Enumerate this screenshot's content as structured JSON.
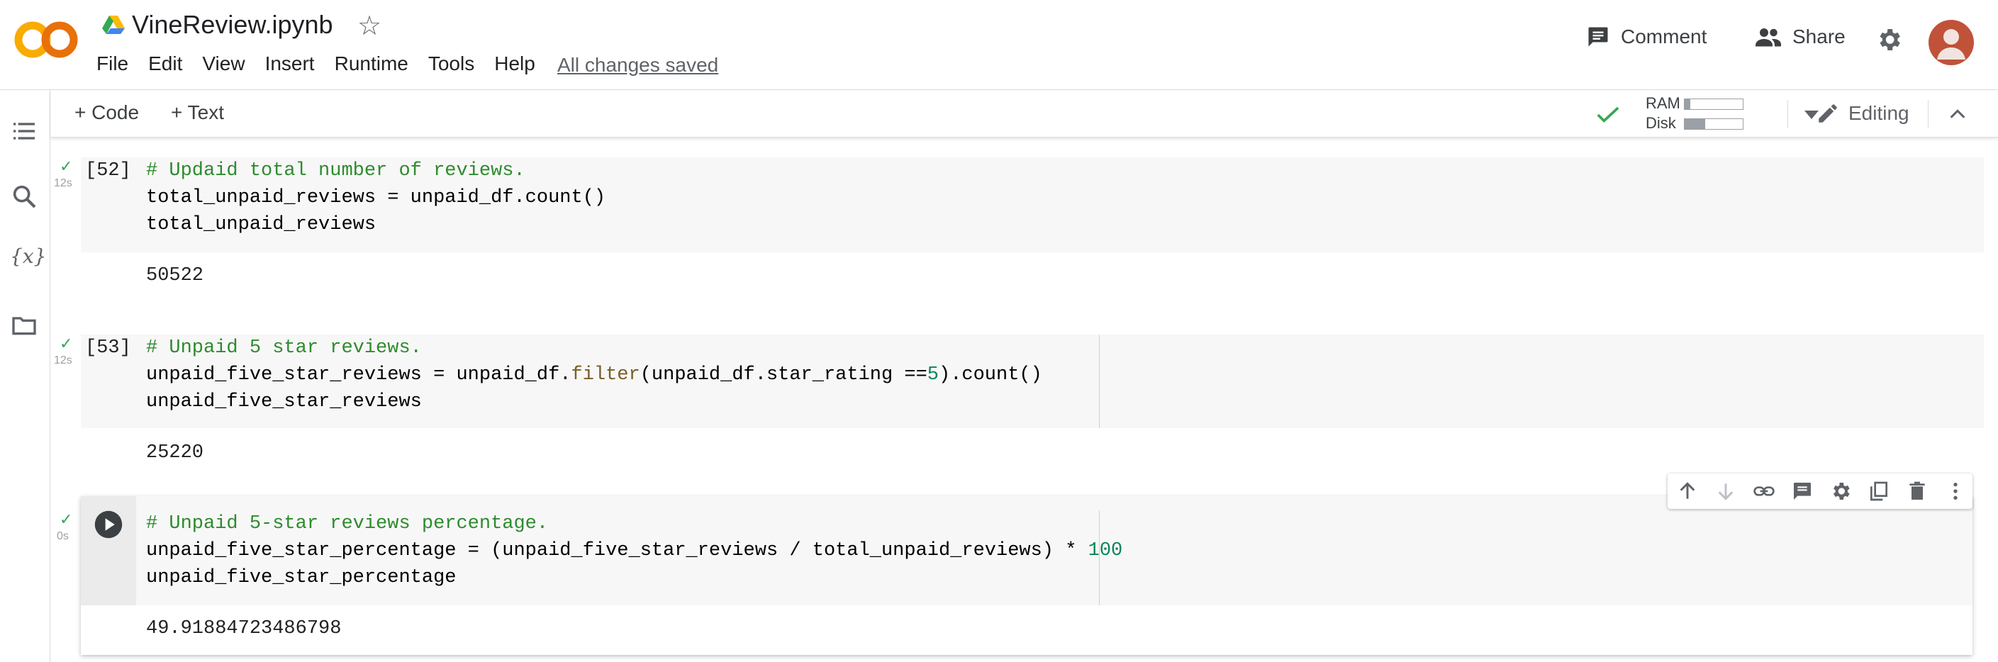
{
  "app": {
    "title": "VineReview.ipynb",
    "saved_status": "All changes saved",
    "menu": [
      "File",
      "Edit",
      "View",
      "Insert",
      "Runtime",
      "Tools",
      "Help"
    ],
    "comment_label": "Comment",
    "share_label": "Share"
  },
  "toolbar": {
    "add_code_label": "+ Code",
    "add_text_label": "+ Text",
    "ram_label": "RAM",
    "disk_label": "Disk",
    "ram_usage": 0.1,
    "disk_usage": 0.35,
    "editing_label": "Editing"
  },
  "cells": [
    {
      "exec_count": "[52]",
      "time": "12s",
      "code": {
        "comment": "# Updaid total number of reviews.",
        "line2": "total_unpaid_reviews = unpaid_df.count()",
        "line3": "total_unpaid_reviews"
      },
      "output": "50522"
    },
    {
      "exec_count": "[53]",
      "time": "12s",
      "code": {
        "comment": "# Unpaid 5 star reviews.",
        "line2_a": "unpaid_five_star_reviews = unpaid_df.",
        "line2_fn": "filter",
        "line2_b": "(unpaid_df.star_rating ==",
        "line2_num": "5",
        "line2_c": ").count()",
        "line3": "unpaid_five_star_reviews"
      },
      "output": "25220"
    },
    {
      "exec_count": "",
      "time": "0s",
      "code": {
        "comment": "# Unpaid 5-star reviews percentage.",
        "line2_a": "unpaid_five_star_percentage = (unpaid_five_star_reviews / total_unpaid_reviews) * ",
        "line2_num": "100",
        "line3": "unpaid_five_star_percentage"
      },
      "output": "49.91884723486798"
    }
  ],
  "icons": {
    "logo": "colab-logo",
    "drive": "google-drive-icon",
    "star": "star-icon",
    "comment": "comment-icon",
    "share": "people-icon",
    "settings": "gear-icon",
    "toc": "table-of-contents-icon",
    "search": "search-icon",
    "variables": "variables-icon",
    "files": "folder-icon",
    "run": "play-circle-icon"
  },
  "colors": {
    "accent_check": "#34a853",
    "comment_green": "#2e8b2e",
    "number_green": "#098658",
    "function_brown": "#795e26",
    "logo_orange": "#f9ab00",
    "avatar": "#c0523a"
  }
}
